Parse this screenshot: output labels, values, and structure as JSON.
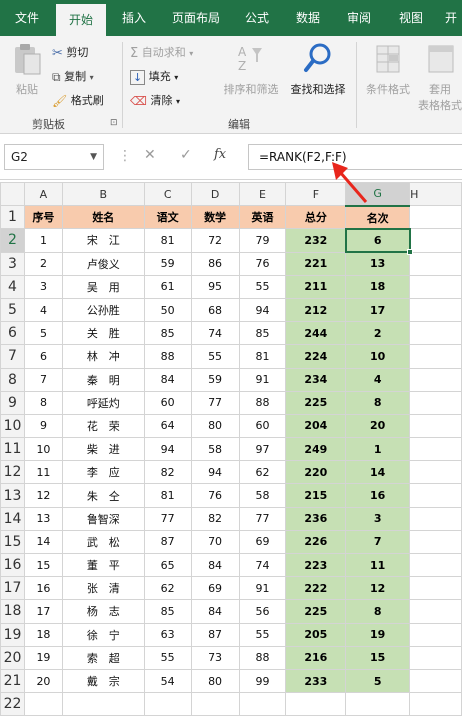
{
  "tabs": [
    "文件",
    "开始",
    "插入",
    "页面布局",
    "公式",
    "数据",
    "审阅",
    "视图",
    "开"
  ],
  "active_tab": "开始",
  "ribbon": {
    "paste": "粘贴",
    "cut": "剪切",
    "copy": "复制",
    "format_painter": "格式刷",
    "clipboard_group": "剪贴板",
    "autosum": "自动求和",
    "fill": "填充",
    "clear": "清除",
    "sort_filter": "排序和筛选",
    "find_select": "查找和选择",
    "editing_group": "编辑",
    "cond_format": "条件格式",
    "table_format_1": "套用",
    "table_format_2": "表格格式"
  },
  "formula_bar": {
    "name_box": "G2",
    "fx": "fx",
    "formula": "=RANK(F2,F:F)"
  },
  "columns": [
    "A",
    "B",
    "C",
    "D",
    "E",
    "F",
    "G",
    "H"
  ],
  "selected_cell": "G2",
  "headers": [
    "序号",
    "姓名",
    "语文",
    "数学",
    "英语",
    "总分",
    "名次"
  ],
  "rows": [
    [
      "1",
      "宋　江",
      "81",
      "72",
      "79",
      "232",
      "6"
    ],
    [
      "2",
      "卢俊义",
      "59",
      "86",
      "76",
      "221",
      "13"
    ],
    [
      "3",
      "吴　用",
      "61",
      "95",
      "55",
      "211",
      "18"
    ],
    [
      "4",
      "公孙胜",
      "50",
      "68",
      "94",
      "212",
      "17"
    ],
    [
      "5",
      "关　胜",
      "85",
      "74",
      "85",
      "244",
      "2"
    ],
    [
      "6",
      "林　冲",
      "88",
      "55",
      "81",
      "224",
      "10"
    ],
    [
      "7",
      "秦　明",
      "84",
      "59",
      "91",
      "234",
      "4"
    ],
    [
      "8",
      "呼延灼",
      "60",
      "77",
      "88",
      "225",
      "8"
    ],
    [
      "9",
      "花　荣",
      "64",
      "80",
      "60",
      "204",
      "20"
    ],
    [
      "10",
      "柴　进",
      "94",
      "58",
      "97",
      "249",
      "1"
    ],
    [
      "11",
      "李　应",
      "82",
      "94",
      "62",
      "220",
      "14"
    ],
    [
      "12",
      "朱　仝",
      "81",
      "76",
      "58",
      "215",
      "16"
    ],
    [
      "13",
      "鲁智深",
      "77",
      "82",
      "77",
      "236",
      "3"
    ],
    [
      "14",
      "武　松",
      "87",
      "70",
      "69",
      "226",
      "7"
    ],
    [
      "15",
      "董　平",
      "65",
      "84",
      "74",
      "223",
      "11"
    ],
    [
      "16",
      "张　清",
      "62",
      "69",
      "91",
      "222",
      "12"
    ],
    [
      "17",
      "杨　志",
      "85",
      "84",
      "56",
      "225",
      "8"
    ],
    [
      "18",
      "徐　宁",
      "63",
      "87",
      "55",
      "205",
      "19"
    ],
    [
      "19",
      "索　超",
      "55",
      "73",
      "88",
      "216",
      "15"
    ],
    [
      "20",
      "戴　宗",
      "54",
      "80",
      "99",
      "233",
      "5"
    ]
  ],
  "colors": {
    "excel_green": "#217346",
    "header_fill": "#f8cbad",
    "data_fill": "#c6e0b4",
    "arrow": "#e8261c"
  }
}
